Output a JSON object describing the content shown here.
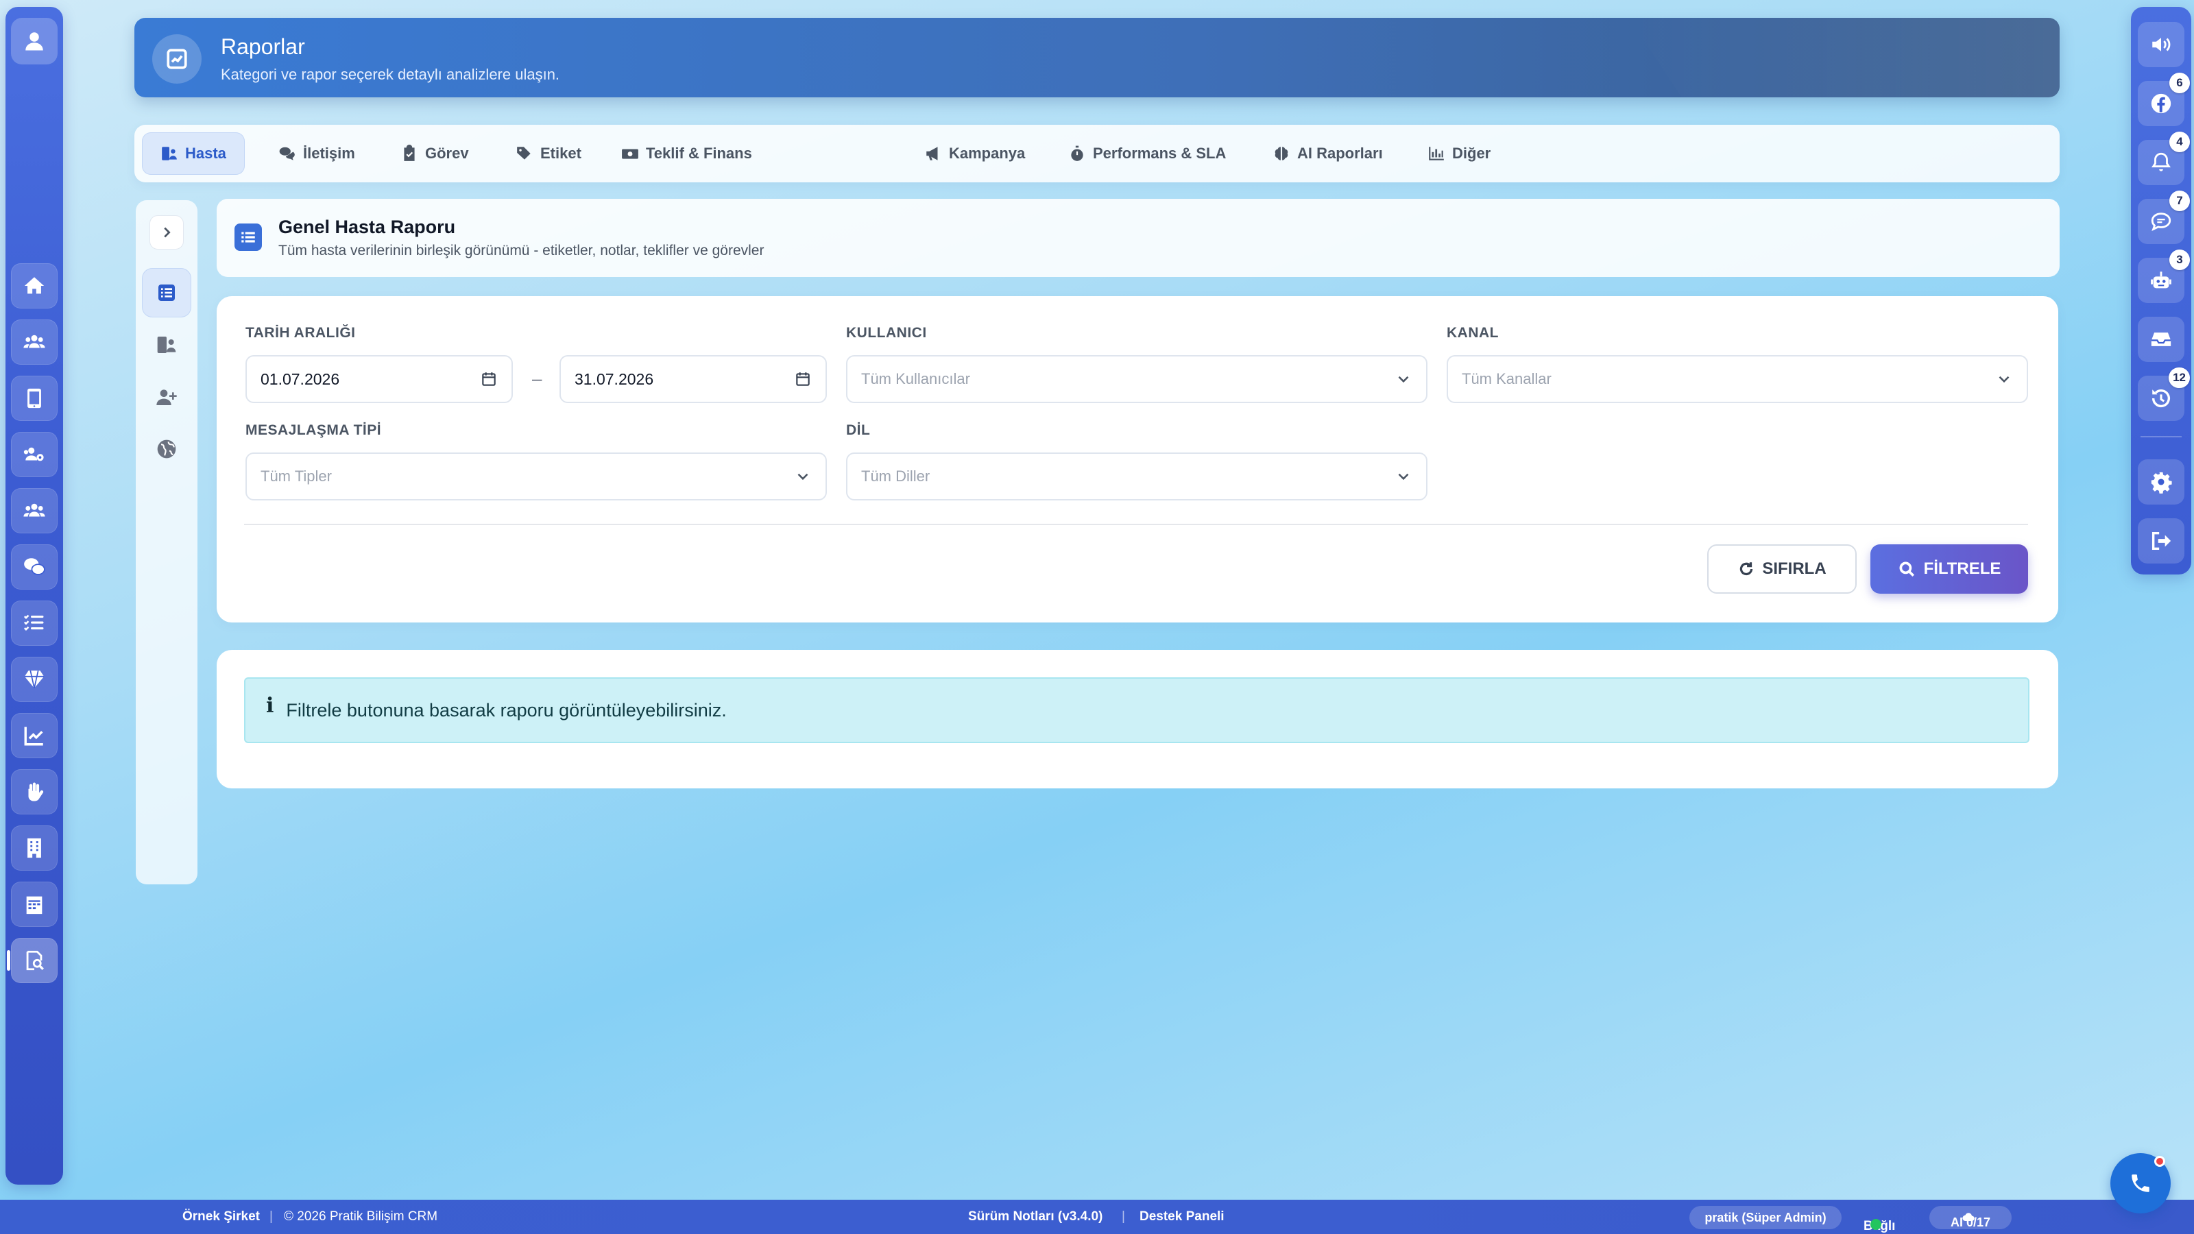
{
  "header": {
    "title": "Raporlar",
    "subtitle": "Kategori ve rapor seçerek detaylı analizlere ulaşın."
  },
  "tabs": [
    {
      "label": "Hasta",
      "icon": "user-list-icon",
      "active": true
    },
    {
      "label": "İletişim",
      "icon": "comments-icon"
    },
    {
      "label": "Görev",
      "icon": "clipboard-check-icon"
    },
    {
      "label": "Etiket",
      "icon": "tags-icon"
    },
    {
      "label": "Teklif & Finans",
      "icon": "money-icon"
    },
    {
      "label": "Kampanya",
      "icon": "megaphone-icon"
    },
    {
      "label": "Performans & SLA",
      "icon": "stopwatch-icon"
    },
    {
      "label": "AI Raporları",
      "icon": "brain-icon"
    },
    {
      "label": "Diğer",
      "icon": "bar-chart-icon"
    }
  ],
  "report": {
    "title": "Genel Hasta Raporu",
    "subtitle": "Tüm hasta verilerinin birleşik görünümü - etiketler, notlar, teklifler ve görevler"
  },
  "filters": {
    "date_label": "TARİH ARALIĞI",
    "date_start": "01.07.2026",
    "date_separator": "–",
    "date_end": "31.07.2026",
    "user_label": "KULLANICI",
    "user_placeholder": "Tüm Kullanıcılar",
    "channel_label": "KANAL",
    "channel_placeholder": "Tüm Kanallar",
    "msgtype_label": "MESAJLAŞMA TİPİ",
    "msgtype_placeholder": "Tüm Tipler",
    "lang_label": "DİL",
    "lang_placeholder": "Tüm Diller",
    "reset_label": "SIFIRLA",
    "filter_label": "FİLTRELE"
  },
  "info": {
    "icon_glyph": "i",
    "message": "Filtrele butonuna basarak raporu görüntüleyebilirsiniz."
  },
  "right_rail_badges": {
    "facebook": "6",
    "notifications": "4",
    "messages": "7",
    "bot": "3",
    "history": "12"
  },
  "footer": {
    "company": "Örnek Şirket",
    "sep": "|",
    "copyright": "© 2026 Pratik Bilişim CRM",
    "release_notes": "Sürüm Notları (v3.4.0)",
    "support": "Destek Paneli",
    "user": "pratik (Süper Admin)",
    "status": "Bağlı",
    "ai": "AI 0/17"
  },
  "colors": {
    "accent": "#3a6fd8",
    "rail": "#3c5cd2",
    "filter_button": "#6a55c8",
    "info_bg": "#cdf1f7",
    "status_ok": "#22c55e"
  }
}
